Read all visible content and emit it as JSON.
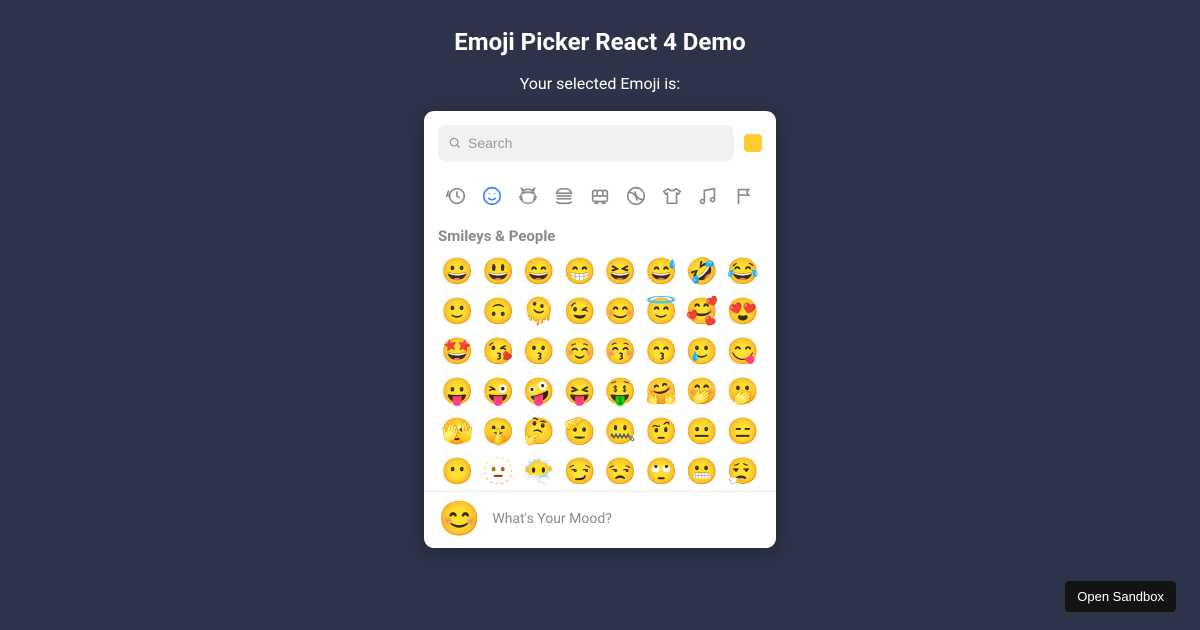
{
  "header": {
    "title": "Emoji Picker React 4 Demo",
    "subtitle": "Your selected Emoji is:"
  },
  "search": {
    "placeholder": "Search",
    "value": ""
  },
  "skin_tone_color": "#ffcc30",
  "categories": [
    {
      "id": "recent",
      "name": "clock-icon",
      "active": false
    },
    {
      "id": "smileys",
      "name": "smiley-icon",
      "active": true
    },
    {
      "id": "animals",
      "name": "cat-icon",
      "active": false
    },
    {
      "id": "food",
      "name": "burger-icon",
      "active": false
    },
    {
      "id": "travel",
      "name": "car-icon",
      "active": false
    },
    {
      "id": "activities",
      "name": "ball-icon",
      "active": false
    },
    {
      "id": "objects",
      "name": "shirt-icon",
      "active": false
    },
    {
      "id": "symbols",
      "name": "music-icon",
      "active": false
    },
    {
      "id": "flags",
      "name": "flag-icon",
      "active": false
    }
  ],
  "section_label": "Smileys & People",
  "emojis": [
    "😀",
    "😃",
    "😄",
    "😁",
    "😆",
    "😅",
    "🤣",
    "😂",
    "🙂",
    "🙃",
    "🫠",
    "😉",
    "😊",
    "😇",
    "🥰",
    "😍",
    "🤩",
    "😘",
    "😗",
    "☺️",
    "😚",
    "😙",
    "🥲",
    "😋",
    "😛",
    "😜",
    "🤪",
    "😝",
    "🤑",
    "🤗",
    "🤭",
    "🫢",
    "🫣",
    "🤫",
    "🤔",
    "🫡",
    "🤐",
    "🤨",
    "😐",
    "😑",
    "😶",
    "🫥",
    "😶‍🌫️",
    "😏",
    "😒",
    "🙄",
    "😬",
    "😮‍💨"
  ],
  "footer": {
    "preview_emoji": "😊",
    "preview_text": "What's Your Mood?"
  },
  "sandbox_button": "Open Sandbox"
}
